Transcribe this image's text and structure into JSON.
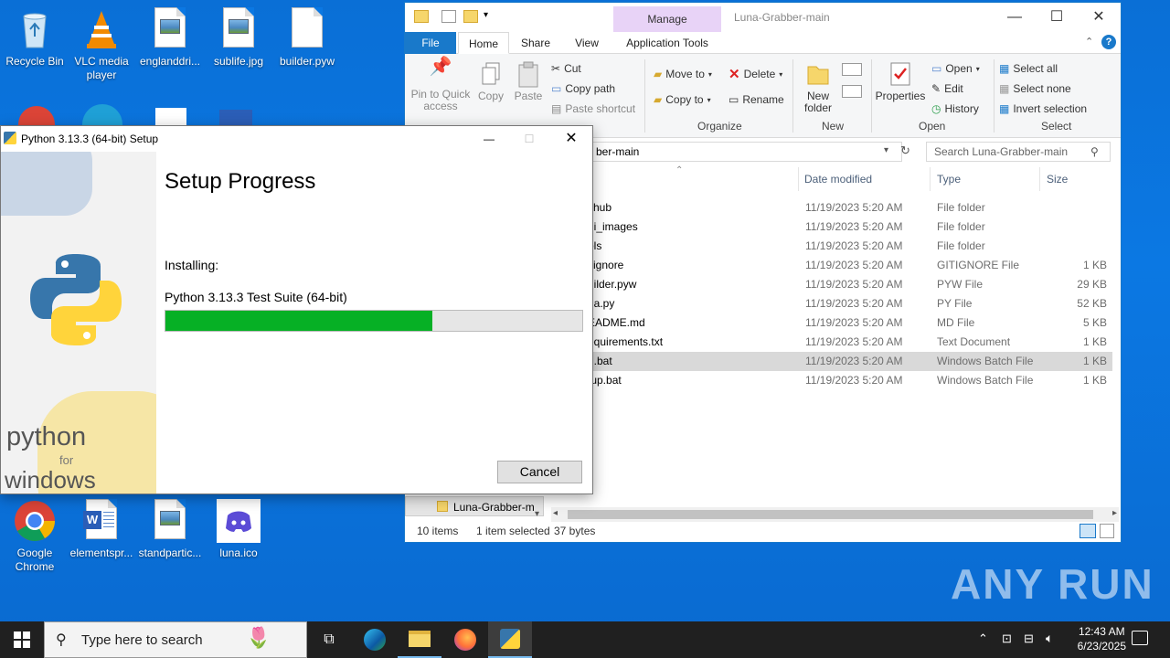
{
  "desktop": {
    "icons_top": [
      {
        "label": "Recycle Bin",
        "icon": "recycle-bin-icon"
      },
      {
        "label": "VLC media player",
        "icon": "vlc-icon"
      },
      {
        "label": "englanddri...",
        "icon": "image-file-icon"
      },
      {
        "label": "sublife.jpg",
        "icon": "image-file-icon"
      },
      {
        "label": "builder.pyw",
        "icon": "file-icon"
      }
    ],
    "icons_bottom": [
      {
        "label": "Google Chrome",
        "icon": "chrome-icon"
      },
      {
        "label": "elementspr...",
        "icon": "word-file-icon"
      },
      {
        "label": "standpartic...",
        "icon": "image-file-icon"
      },
      {
        "label": "luna.ico",
        "icon": "discord-icon"
      }
    ]
  },
  "explorer": {
    "title": "Luna-Grabber-main",
    "manage_tab": "Manage",
    "tabs": [
      "File",
      "Home",
      "Share",
      "View",
      "Application Tools"
    ],
    "ribbon": {
      "clipboard": {
        "pin": "Pin to Quick access",
        "copy": "Copy",
        "paste": "Paste",
        "cut": "Cut",
        "copy_path": "Copy path",
        "paste_shortcut": "Paste shortcut",
        "label": "Clipboard"
      },
      "organize": {
        "move_to": "Move to",
        "copy_to": "Copy to",
        "delete": "Delete",
        "rename": "Rename",
        "label": "Organize"
      },
      "new": {
        "new_folder": "New folder",
        "label": "New"
      },
      "open": {
        "properties": "Properties",
        "open": "Open",
        "edit": "Edit",
        "history": "History",
        "label": "Open"
      },
      "select": {
        "select_all": "Select all",
        "select_none": "Select none",
        "invert": "Invert selection",
        "label": "Select"
      }
    },
    "address": "ber-main",
    "search_placeholder": "Search Luna-Grabber-main",
    "columns": {
      "date": "Date modified",
      "type": "Type",
      "size": "Size"
    },
    "rows": [
      {
        "name": "ithub",
        "date": "11/19/2023 5:20 AM",
        "type": "File folder",
        "size": ""
      },
      {
        "name": "ui_images",
        "date": "11/19/2023 5:20 AM",
        "type": "File folder",
        "size": ""
      },
      {
        "name": "ols",
        "date": "11/19/2023 5:20 AM",
        "type": "File folder",
        "size": ""
      },
      {
        "name": "itignore",
        "date": "11/19/2023 5:20 AM",
        "type": "GITIGNORE File",
        "size": "1 KB"
      },
      {
        "name": "uilder.pyw",
        "date": "11/19/2023 5:20 AM",
        "type": "PYW File",
        "size": "29 KB"
      },
      {
        "name": "na.py",
        "date": "11/19/2023 5:20 AM",
        "type": "PY File",
        "size": "52 KB"
      },
      {
        "name": "EADME.md",
        "date": "11/19/2023 5:20 AM",
        "type": "MD File",
        "size": "5 KB"
      },
      {
        "name": "equirements.txt",
        "date": "11/19/2023 5:20 AM",
        "type": "Text Document",
        "size": "1 KB"
      },
      {
        "name": "n.bat",
        "date": "11/19/2023 5:20 AM",
        "type": "Windows Batch File",
        "size": "1 KB",
        "selected": true
      },
      {
        "name": "tup.bat",
        "date": "11/19/2023 5:20 AM",
        "type": "Windows Batch File",
        "size": "1 KB"
      }
    ],
    "nav_item": "Luna-Grabber-m",
    "status": {
      "items": "10 items",
      "selected": "1 item selected",
      "bytes": "37 bytes"
    }
  },
  "setup": {
    "title": "Python 3.13.3 (64-bit) Setup",
    "heading": "Setup Progress",
    "installing_label": "Installing:",
    "current_item": "Python 3.13.3 Test Suite (64-bit)",
    "progress": 0.64,
    "cancel": "Cancel",
    "brand_python": "python",
    "brand_for": "for",
    "brand_windows": "windows"
  },
  "taskbar": {
    "search_placeholder": "Type here to search",
    "time": "12:43 AM",
    "date": "6/23/2025"
  },
  "watermark": "ANY RUN",
  "colors": {
    "accent": "#1979ca",
    "progress": "#06b025",
    "manage": "#e8d3f7"
  }
}
